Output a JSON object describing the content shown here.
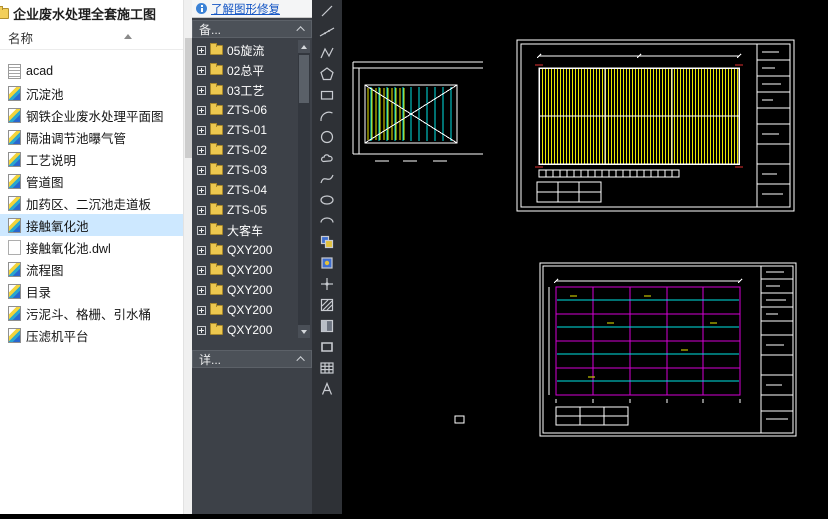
{
  "file_panel": {
    "title": "企业废水处理全套施工图",
    "columns": {
      "name": "名称"
    },
    "items": [
      {
        "label": "acad",
        "type": "acad"
      },
      {
        "label": "沉淀池",
        "type": "dwg"
      },
      {
        "label": "钢铁企业废水处理平面图",
        "type": "dwg"
      },
      {
        "label": "隔油调节池曝气管",
        "type": "dwg"
      },
      {
        "label": "工艺说明",
        "type": "dwg"
      },
      {
        "label": "管道图",
        "type": "dwg"
      },
      {
        "label": "加药区、二沉池走道板",
        "type": "dwg"
      },
      {
        "label": "接触氧化池",
        "type": "dwg",
        "selected": true
      },
      {
        "label": "接触氧化池.dwl",
        "type": "dwl"
      },
      {
        "label": "流程图",
        "type": "dwg"
      },
      {
        "label": "目录",
        "type": "dwg"
      },
      {
        "label": "污泥斗、格栅、引水桶",
        "type": "dwg"
      },
      {
        "label": "压滤机平台",
        "type": "dwg"
      }
    ]
  },
  "side_panel": {
    "info_link": "了解图形修复",
    "sheets_header": "备...",
    "details_header": "详...",
    "tree_items": [
      {
        "label": "05旋流"
      },
      {
        "label": "02总平"
      },
      {
        "label": "03工艺"
      },
      {
        "label": "ZTS-06"
      },
      {
        "label": "ZTS-01"
      },
      {
        "label": "ZTS-02"
      },
      {
        "label": "ZTS-03"
      },
      {
        "label": "ZTS-04"
      },
      {
        "label": "ZTS-05"
      },
      {
        "label": "大客车"
      },
      {
        "label": "QXY200"
      },
      {
        "label": "QXY200"
      },
      {
        "label": "QXY200"
      },
      {
        "label": "QXY200"
      },
      {
        "label": "QXY200"
      }
    ]
  },
  "toolbar": {
    "tools": [
      "line",
      "construction-line",
      "polyline",
      "polygon",
      "rectangle",
      "arc",
      "circle",
      "revision-cloud",
      "spline",
      "ellipse",
      "ellipse-arc",
      "insert-block",
      "create-block",
      "point",
      "hatch",
      "gradient",
      "region",
      "table",
      "multiline-text"
    ]
  },
  "canvas": {
    "colors": {
      "hatch": "#e8e800",
      "grid": "#d400d4",
      "water": "#00e5e5",
      "lines": "#ffffff",
      "marks": "#e03030"
    }
  }
}
